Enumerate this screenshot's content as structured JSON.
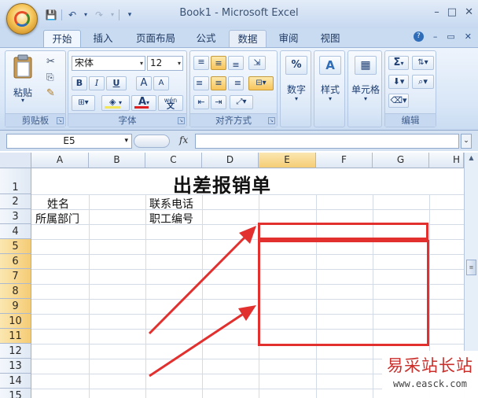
{
  "window": {
    "title": "Book1 - Microsoft Excel",
    "controls": [
      "–",
      "□",
      "✕"
    ]
  },
  "quick_access": [
    "save-icon",
    "undo-icon",
    "redo-icon",
    "customize-icon"
  ],
  "tabs": [
    {
      "label": "开始",
      "active": true
    },
    {
      "label": "插入"
    },
    {
      "label": "页面布局"
    },
    {
      "label": "公式"
    },
    {
      "label": "数据",
      "highlighted": true
    },
    {
      "label": "审阅"
    },
    {
      "label": "视图"
    }
  ],
  "ribbon": {
    "clipboard": {
      "label": "剪贴板",
      "paste": "粘贴"
    },
    "font": {
      "label": "字体",
      "font_name": "宋体",
      "font_size": "12",
      "bold": "B",
      "italic": "I",
      "underline": "U",
      "grow": "A",
      "shrink": "A",
      "color": "A",
      "phonetic": "wén"
    },
    "alignment": {
      "label": "对齐方式"
    },
    "number": {
      "label": "数字",
      "symbol": "%"
    },
    "styles": {
      "label": "样式",
      "symbol": "A"
    },
    "cells": {
      "label": "单元格"
    },
    "editing": {
      "label": "编辑",
      "sum": "Σ"
    }
  },
  "formula_bar": {
    "name_box": "E5",
    "fx": "fx",
    "content": ""
  },
  "sheet": {
    "columns": [
      "A",
      "B",
      "C",
      "D",
      "E",
      "F",
      "G",
      "H"
    ],
    "rows": [
      "1",
      "2",
      "3",
      "4",
      "5",
      "6",
      "7",
      "8",
      "9",
      "10",
      "11",
      "12",
      "13",
      "14",
      "15"
    ],
    "title": "出差报销单",
    "cells": {
      "a2": "姓名",
      "a3": "所属部门",
      "c2": "联系电话",
      "c3": "职工编号"
    }
  },
  "watermark": {
    "name": "易采站长站",
    "url": "www.easck.com"
  },
  "colors": {
    "accent_red": "#e2302f",
    "selection": "#f5cc75",
    "ribbon": "#d8e6f7"
  }
}
